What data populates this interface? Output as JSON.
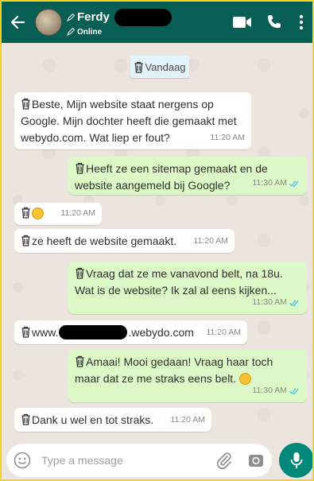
{
  "header": {
    "contact_name": "Ferdy",
    "status": "Online"
  },
  "date_chip": "Vandaag",
  "messages": [
    {
      "direction": "in",
      "text": "Beste, Mijn website staat nergens op Google. Mijn dochter heeft die gemaakt met webydo.com. Wat liep er fout?",
      "time": "11:20 AM"
    },
    {
      "direction": "out",
      "text": "Heeft ze een sitemap gemaakt en de website aangemeld bij Google?",
      "time": "11:30 AM"
    },
    {
      "direction": "in",
      "text": "",
      "time": "11:20 AM"
    },
    {
      "direction": "in",
      "text": "ze heeft de website gemaakt.",
      "time": "11:20 AM"
    },
    {
      "direction": "out",
      "text": "Vraag dat ze me vanavond belt, na 18u. Wat is de website? Ik zal al eens kijken...",
      "time": "11:30 AM"
    },
    {
      "direction": "in",
      "text_prefix": "www.",
      "text_suffix": ".webydo.com",
      "time": "11:20 AM"
    },
    {
      "direction": "out",
      "text": "Amaai! Mooi gedaan! Vraag haar toch maar dat ze me straks eens belt.",
      "time": "11:30 AM"
    },
    {
      "direction": "in",
      "text": "Dank u wel en tot straks.",
      "time": "11:20 AM"
    }
  ],
  "composer": {
    "placeholder": "Type a message"
  },
  "colors": {
    "header": "#075e54",
    "outgoing_bubble": "#dcf8c6",
    "incoming_bubble": "#ffffff",
    "read_ticks": "#4fc3f7",
    "mic_button": "#00897b",
    "frame_border": "#f5d31f"
  },
  "icons": [
    "back-arrow-icon",
    "video-call-icon",
    "phone-icon",
    "more-menu-icon",
    "trash-icon",
    "emoji-icon",
    "attach-icon",
    "camera-icon",
    "mic-icon",
    "double-tick-icon",
    "pencil-icon"
  ]
}
